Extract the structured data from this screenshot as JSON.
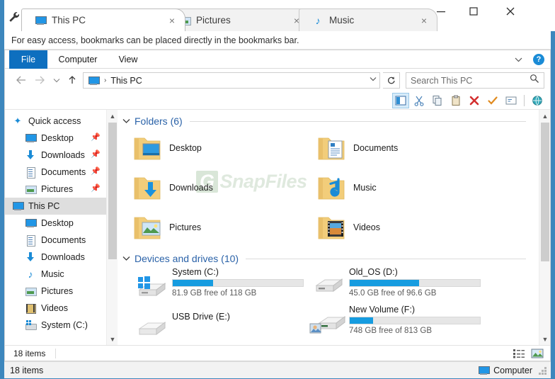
{
  "window": {
    "wrench_icon": "wrench-icon",
    "controls": {
      "minimize": "minimize-icon",
      "maximize": "maximize-icon",
      "close": "close-icon"
    }
  },
  "tabs": [
    {
      "label": "This PC",
      "icon": "monitor-icon",
      "close": "×",
      "active": true
    },
    {
      "label": "Pictures",
      "icon": "picture-icon",
      "close": "×",
      "active": false
    },
    {
      "label": "Music",
      "icon": "music-note-icon",
      "close": "×",
      "active": false
    }
  ],
  "new_tab": {
    "label": "+",
    "name": "new-tab-button"
  },
  "bookmark_bar": {
    "message": "For easy access, bookmarks can be placed directly in the bookmarks bar."
  },
  "ribbon": {
    "file": "File",
    "computer": "Computer",
    "view": "View",
    "expand_icon": "chevron-down-icon",
    "help": "?"
  },
  "address": {
    "back_icon": "back-arrow-icon",
    "forward_icon": "forward-arrow-icon",
    "recent_icon": "chevron-down-icon",
    "up_icon": "up-arrow-icon",
    "crumb_icon": "monitor-icon",
    "separator": "›",
    "path": "This PC",
    "dropdown_icon": "chevron-down-icon",
    "refresh_icon": "refresh-icon"
  },
  "search": {
    "placeholder": "Search This PC",
    "icon": "search-icon"
  },
  "toolbar": [
    {
      "name": "preview-pane-icon",
      "glyph": "pane",
      "selected": true
    },
    {
      "name": "cut-icon",
      "glyph": "scissors",
      "selected": false
    },
    {
      "name": "copy-icon",
      "glyph": "copy",
      "selected": false
    },
    {
      "name": "paste-icon",
      "glyph": "clipboard",
      "selected": false
    },
    {
      "name": "delete-icon",
      "glyph": "x",
      "selected": false
    },
    {
      "name": "check-icon",
      "glyph": "check",
      "selected": false
    },
    {
      "name": "rename-icon",
      "glyph": "rename",
      "selected": false
    },
    {
      "name": "globe-icon",
      "glyph": "globe",
      "selected": false
    }
  ],
  "navpane": {
    "items": [
      {
        "label": "Quick access",
        "icon": "star-pin-icon",
        "indent": 1,
        "pinned": false,
        "selected": false
      },
      {
        "label": "Desktop",
        "icon": "monitor-icon",
        "indent": 2,
        "pinned": true,
        "selected": false
      },
      {
        "label": "Downloads",
        "icon": "download-icon",
        "indent": 2,
        "pinned": true,
        "selected": false
      },
      {
        "label": "Documents",
        "icon": "document-icon",
        "indent": 2,
        "pinned": true,
        "selected": false
      },
      {
        "label": "Pictures",
        "icon": "picture-icon",
        "indent": 2,
        "pinned": true,
        "selected": false
      },
      {
        "label": "This PC",
        "icon": "monitor-icon",
        "indent": 1,
        "pinned": false,
        "selected": true
      },
      {
        "label": "Desktop",
        "icon": "monitor-icon",
        "indent": 2,
        "pinned": false,
        "selected": false
      },
      {
        "label": "Documents",
        "icon": "document-icon",
        "indent": 2,
        "pinned": false,
        "selected": false
      },
      {
        "label": "Downloads",
        "icon": "download-icon",
        "indent": 2,
        "pinned": false,
        "selected": false
      },
      {
        "label": "Music",
        "icon": "music-note-icon",
        "indent": 2,
        "pinned": false,
        "selected": false
      },
      {
        "label": "Pictures",
        "icon": "picture-icon",
        "indent": 2,
        "pinned": false,
        "selected": false
      },
      {
        "label": "Videos",
        "icon": "video-icon",
        "indent": 2,
        "pinned": false,
        "selected": false
      },
      {
        "label": "System (C:)",
        "icon": "drive-icon",
        "indent": 2,
        "pinned": false,
        "selected": false
      }
    ]
  },
  "content": {
    "folders_group": {
      "title": "Folders (6)",
      "chevron": "⌄"
    },
    "folders": [
      {
        "label": "Desktop",
        "icon": "folder-desktop-icon"
      },
      {
        "label": "Documents",
        "icon": "folder-documents-icon"
      },
      {
        "label": "Downloads",
        "icon": "folder-downloads-icon"
      },
      {
        "label": "Music",
        "icon": "folder-music-icon"
      },
      {
        "label": "Pictures",
        "icon": "folder-pictures-icon"
      },
      {
        "label": "Videos",
        "icon": "folder-videos-icon"
      }
    ],
    "drives_group": {
      "title": "Devices and drives (10)",
      "chevron": "⌄"
    },
    "drives": [
      {
        "name": "System (C:)",
        "free": "81.9 GB free of 118 GB",
        "used_pct": 31,
        "icon": "drive-windows-icon",
        "has_bar": true
      },
      {
        "name": "Old_OS (D:)",
        "free": "45.0 GB free of 96.6 GB",
        "used_pct": 53,
        "icon": "drive-icon",
        "has_bar": true
      },
      {
        "name": "USB Drive (E:)",
        "free": "",
        "used_pct": 0,
        "icon": "drive-icon",
        "has_bar": false
      },
      {
        "name": "New Volume (F:)",
        "free": "748 GB free of 813 GB",
        "used_pct": 18,
        "icon": "drive-photo-icon",
        "has_bar": true
      }
    ],
    "watermark": {
      "badge": "G",
      "text": "SnapFiles"
    }
  },
  "inner_status": {
    "items_count": "18 items",
    "view_details_icon": "details-view-icon",
    "view_thumbs_icon": "thumbnail-view-icon"
  },
  "outer_status": {
    "items_count": "18 items",
    "location_icon": "monitor-icon",
    "location_label": "Computer",
    "grip": "resize-grip"
  },
  "colors": {
    "window_border": "#3d87bd",
    "file_tab": "#0e6fbf",
    "group_header": "#2a62a8",
    "bar_fill": "#169ce0",
    "selection": "#dedede",
    "folder": "#f5d07a"
  }
}
